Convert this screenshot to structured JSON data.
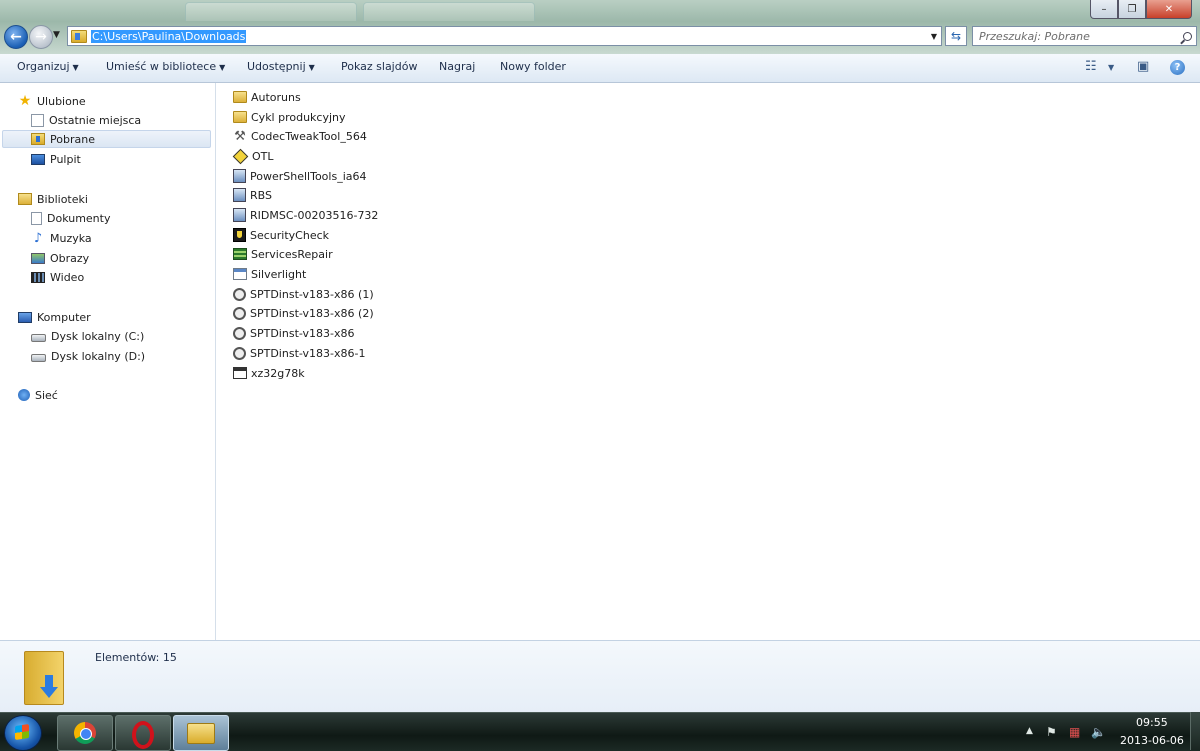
{
  "window": {
    "address": "C:\\Users\\Paulina\\Downloads",
    "search_placeholder": "Przeszukaj: Pobrane",
    "minimize": "–",
    "maximize": "❐",
    "close": "✕"
  },
  "toolbar": {
    "organize": "Organizuj",
    "include_library": "Umieść w bibliotece",
    "share": "Udostępnij",
    "slideshow": "Pokaz slajdów",
    "burn": "Nagraj",
    "new_folder": "Nowy folder"
  },
  "sidebar": {
    "favorites": "Ulubione",
    "recent": "Ostatnie miejsca",
    "downloads": "Pobrane",
    "desktop": "Pulpit",
    "libraries": "Biblioteki",
    "documents": "Dokumenty",
    "music": "Muzyka",
    "pictures": "Obrazy",
    "videos": "Wideo",
    "computer": "Komputer",
    "drive_c": "Dysk lokalny (C:)",
    "drive_d": "Dysk lokalny (D:)",
    "network": "Sieć"
  },
  "files": [
    {
      "name": "Autoruns",
      "icon": "folder-icon"
    },
    {
      "name": "Cykl produkcyjny",
      "icon": "folder-icon"
    },
    {
      "name": "CodecTweakTool_564",
      "icon": "tools-icon"
    },
    {
      "name": "OTL",
      "icon": "otl-icon"
    },
    {
      "name": "PowerShellTools_ia64",
      "icon": "installer-icon"
    },
    {
      "name": "RBS",
      "icon": "installer-icon"
    },
    {
      "name": "RIDMSC-00203516-732",
      "icon": "installer-icon"
    },
    {
      "name": "SecurityCheck",
      "icon": "shield-icon"
    },
    {
      "name": "ServicesRepair",
      "icon": "services-icon"
    },
    {
      "name": "Silverlight",
      "icon": "app-icon"
    },
    {
      "name": "SPTDinst-v183-x86 (1)",
      "icon": "sptd-icon"
    },
    {
      "name": "SPTDinst-v183-x86 (2)",
      "icon": "sptd-icon"
    },
    {
      "name": "SPTDinst-v183-x86",
      "icon": "sptd-icon"
    },
    {
      "name": "SPTDinst-v183-x86-1",
      "icon": "sptd-icon"
    },
    {
      "name": "xz32g78k",
      "icon": "exe-icon"
    }
  ],
  "details": {
    "count_text": "Elementów: 15"
  },
  "taskbar": {
    "time": "09:55",
    "date": "2013-06-06"
  }
}
